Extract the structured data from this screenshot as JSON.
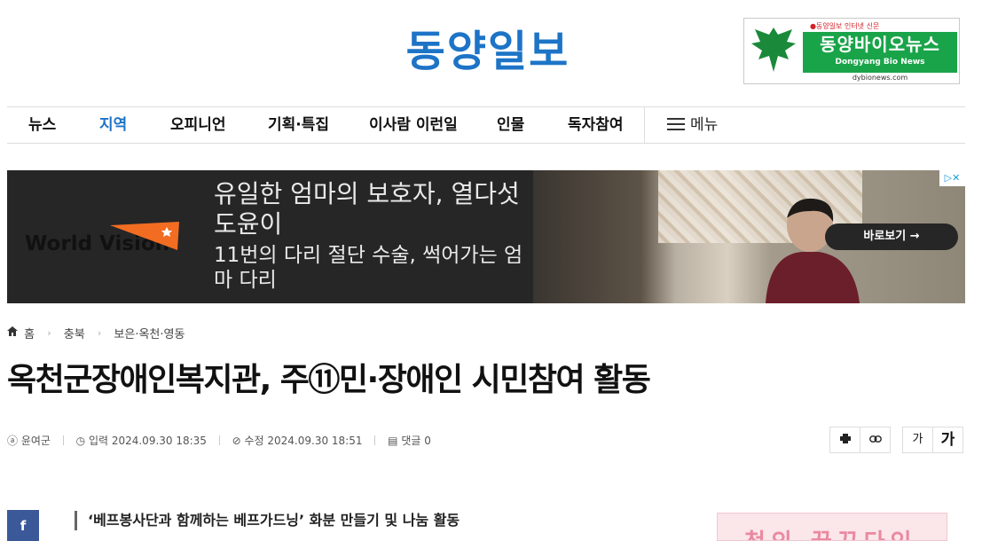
{
  "header": {
    "logo": "동양일보",
    "bio_banner": {
      "tag": "●동양일보 인터넷 신문",
      "title": "동양바이오뉴스",
      "subtitle": "Dongyang Bio News",
      "url": "dybionews.com",
      "brand_color": "#1aa44a"
    }
  },
  "nav": {
    "items": [
      {
        "label": "뉴스"
      },
      {
        "label": "지역"
      },
      {
        "label": "오피니언"
      },
      {
        "label": "기획·특집"
      },
      {
        "label": "이사람 이런일"
      },
      {
        "label": "인물"
      },
      {
        "label": "독자참여"
      }
    ],
    "active": "지역",
    "menu_label": "메뉴",
    "accent": "#1d74c7"
  },
  "ad": {
    "brand": "World Vision",
    "headline": "유일한 엄마의 보호자, 열다섯 도윤이",
    "sub": "11번의 다리 절단 수술, 썩어가는 엄마 다리",
    "cta": "바로보기 →",
    "choices": "▷✕"
  },
  "breadcrumb": {
    "home": "홈",
    "level1": "충북",
    "level2": "보은·옥천·영동"
  },
  "article": {
    "title": "옥천군장애인복지관, 주⑪민·장애인 시민참여 활동",
    "author": "윤여군",
    "published": "입력 2024.09.30 18:35",
    "updated": "수정 2024.09.30 18:51",
    "comments": "댓글 0",
    "subhead": "‘베프봉사단과 함께하는 베프가드닝’ 화분 만들기 및 나눔 활동"
  },
  "tools": {
    "font_small": "가",
    "font_large": "가"
  },
  "share": {
    "facebook": "f"
  },
  "side_ad": {
    "text": "청의 꿈꾸다인"
  }
}
